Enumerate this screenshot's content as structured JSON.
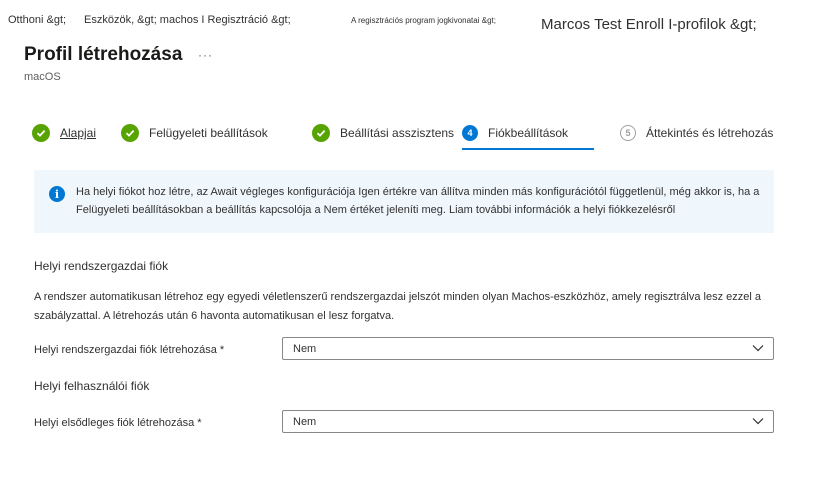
{
  "breadcrumb": {
    "home": "Otthoni &gt;",
    "devices": "Eszközök, &gt; machos I Regisztráció &gt;",
    "program": "A regisztrációs program jogkivonatai &gt;",
    "profiles": "Marcos Test Enroll I-profilok &gt;"
  },
  "header": {
    "title": "Profil létrehozása",
    "more_icon": "more-icon",
    "subtitle": "macOS"
  },
  "wizard": {
    "steps": [
      {
        "label": "Alapjai",
        "state": "completed",
        "icon": "check-icon"
      },
      {
        "label": "Felügyeleti beállítások",
        "state": "completed",
        "icon": "check-icon"
      },
      {
        "label": "Beállítási asszisztens",
        "state": "completed",
        "icon": "check-icon"
      },
      {
        "number": "4",
        "label": "Fiókbeállítások",
        "state": "active"
      },
      {
        "number": "5",
        "label": "Áttekintés és létrehozás",
        "state": "inactive"
      }
    ],
    "completed_color": "#57a300",
    "active_color": "#0078d4"
  },
  "info": {
    "icon": "info-icon",
    "text": "Ha helyi fiókot hoz létre, az Await végleges konfigurációja Igen értékre van állítva minden más konfigurációtól függetlenül, még akkor is, ha a Felügyeleti beállításokban a beállítás kapcsolója a Nem értéket jeleníti meg. Liam további információk a helyi fiókkezelésről"
  },
  "admin_section": {
    "heading": "Helyi rendszergazdai fiók",
    "description": "A rendszer automatikusan létrehoz egy egyedi véletlenszerű rendszergazdai jelszót minden olyan Machos-eszközhöz, amely regisztrálva lesz ezzel a szabályzattal. A létrehozás után 6 havonta automatikusan el lesz forgatva.",
    "field_label": "Helyi rendszergazdai fiók létrehozása",
    "required_mark": "*",
    "value": "Nem"
  },
  "user_section": {
    "heading": "Helyi felhasználói fiók",
    "field_label": "Helyi elsődleges fiók létrehozása",
    "required_mark": "*",
    "value": "Nem"
  }
}
